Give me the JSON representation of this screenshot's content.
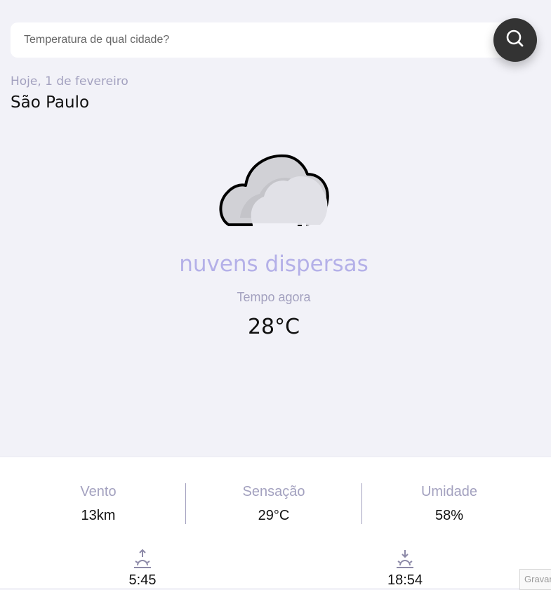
{
  "search": {
    "placeholder": "Temperatura de qual cidade?",
    "icon": "search-icon"
  },
  "location": {
    "date": "Hoje, 1 de fevereiro",
    "city": "São Paulo"
  },
  "current": {
    "icon": "cloud-icon",
    "description": "nuvens dispersas",
    "time_label": "Tempo agora",
    "temperature": "28°C"
  },
  "stats": [
    {
      "label": "Vento",
      "value": "13km"
    },
    {
      "label": "Sensação",
      "value": "29°C"
    },
    {
      "label": "Umidade",
      "value": "58%"
    }
  ],
  "sun": {
    "sunrise": {
      "icon": "sunrise-icon",
      "time": "5:45"
    },
    "sunset": {
      "icon": "sunset-icon",
      "time": "18:54"
    }
  },
  "recaptcha": {
    "label": "Gravar"
  },
  "colors": {
    "background": "#f2f2f8",
    "accent": "#b4b0e8",
    "muted": "#a3a1bf",
    "button": "#333333"
  }
}
